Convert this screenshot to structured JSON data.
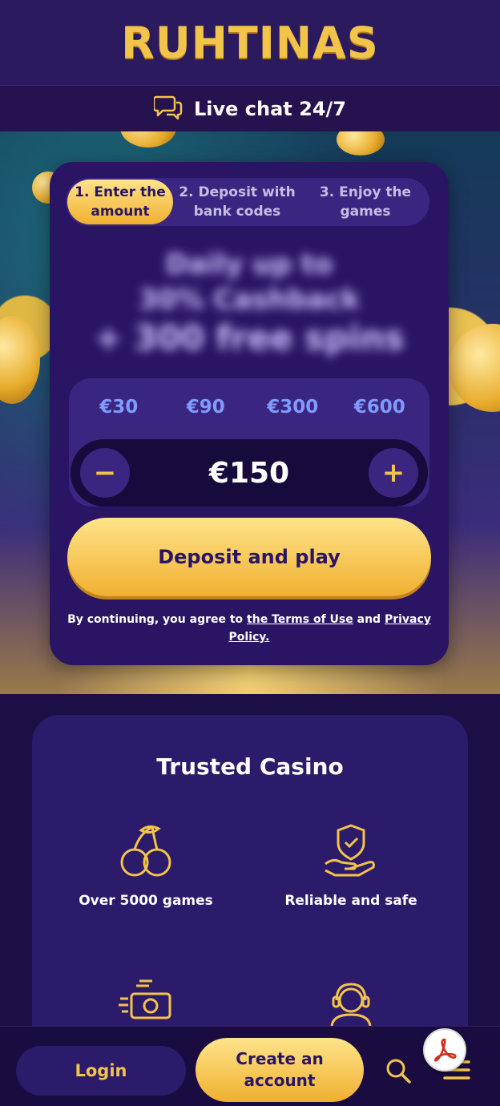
{
  "header": {
    "logo": "RUHTINAS"
  },
  "livechat": {
    "label": "Live chat 24/7",
    "icon": "chat-bubbles-icon"
  },
  "steps": [
    {
      "label": "1. Enter the amount",
      "active": true
    },
    {
      "label": "2. Deposit with bank codes",
      "active": false
    },
    {
      "label": "3. Enjoy the games",
      "active": false
    }
  ],
  "promo": {
    "line1": "Daily up to",
    "line2": "30% Cashback",
    "line3": "+ 300 free spins"
  },
  "amount": {
    "presets": [
      "€30",
      "€90",
      "€300",
      "€600"
    ],
    "value": "€150",
    "minus": "−",
    "plus": "+"
  },
  "deposit": {
    "label": "Deposit and play"
  },
  "terms": {
    "prefix": "By continuing, you agree to",
    "terms_link": "the Terms of Use",
    "and": "and",
    "privacy_link": "Privacy Policy."
  },
  "trusted": {
    "title": "Trusted Casino",
    "features": [
      {
        "label": "Over 5000 games",
        "icon": "cherries-icon"
      },
      {
        "label": "Reliable and safe",
        "icon": "shield-hand-icon"
      },
      {
        "label": "",
        "icon": "money-fast-icon"
      },
      {
        "label": "",
        "icon": "support-agent-icon"
      }
    ]
  },
  "bottom_bar": {
    "login": "Login",
    "create_account": "Create an account"
  },
  "colors": {
    "gold": "#f3c44a",
    "purple_dark": "#1d0f45",
    "card": "#2a1565",
    "preset_blue": "#7f9bff"
  }
}
